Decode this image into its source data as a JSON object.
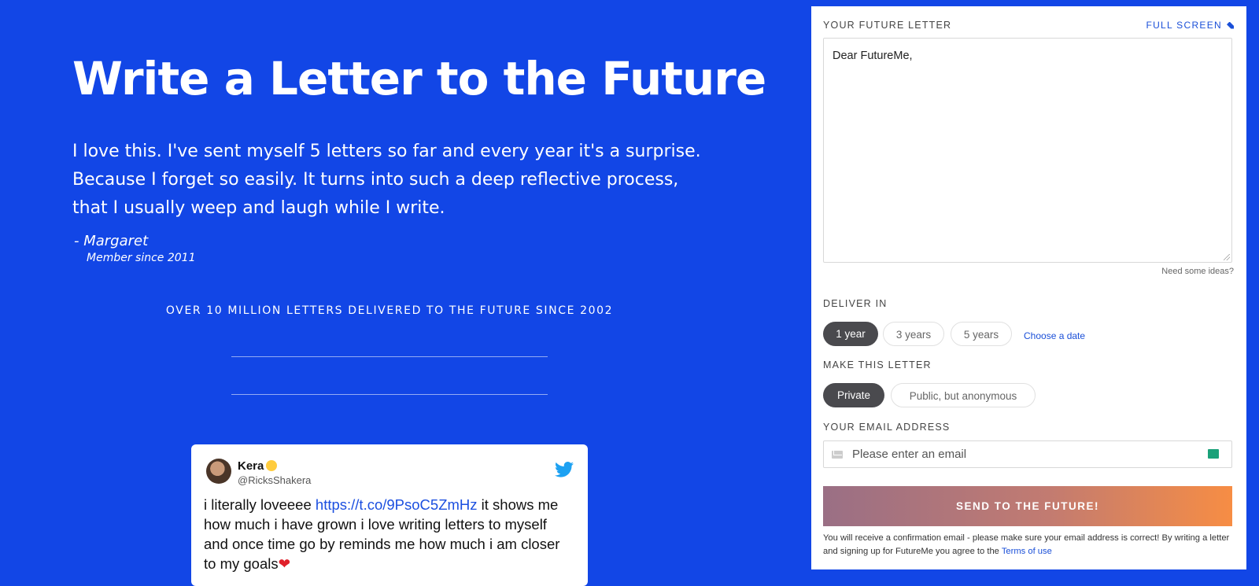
{
  "hero": {
    "title": "Write a Letter to the Future",
    "quote": "I love this. I've sent myself 5 letters so far and every year it's a surprise. Because I forget so easily. It turns into such a deep reflective process, that I usually weep and laugh while I write.",
    "author": "- Margaret",
    "member_since": "Member since 2011",
    "stats": "OVER 10 MILLION LETTERS DELIVERED TO THE FUTURE SINCE 2002"
  },
  "tweet": {
    "name": "Kera",
    "handle": "@RicksShakera",
    "text_before": "i literally loveeee ",
    "link": "https://t.co/9PsoC5ZmHz",
    "text_after": " it shows me how much i have grown i love writing letters to myself and once time go by reminds me how much i am closer to my goals",
    "heart": "❤"
  },
  "form": {
    "letter_label": "YOUR FUTURE LETTER",
    "full_screen": "FULL SCREEN",
    "letter_value": "Dear FutureMe,",
    "ideas_link": "Need some ideas?",
    "deliver_label": "DELIVER IN",
    "deliver_options": [
      "1 year",
      "3 years",
      "5 years"
    ],
    "deliver_selected": "1 year",
    "choose_date": "Choose a date",
    "privacy_label": "MAKE THIS LETTER",
    "privacy_options": [
      "Private",
      "Public, but anonymous"
    ],
    "privacy_selected": "Private",
    "email_label": "YOUR EMAIL ADDRESS",
    "email_placeholder": "Please enter an email",
    "send_button": "SEND TO THE FUTURE!",
    "fine_print": "You will receive a confirmation email - please make sure your email address is correct! By writing a letter and signing up for FutureMe you agree to the ",
    "terms_link": "Terms of use"
  },
  "colors": {
    "background": "#1246e6",
    "accent": "#1a4fd8",
    "pill_selected": "#4a4a4e",
    "button_start": "#9a6f85",
    "button_end": "#f78d44"
  }
}
